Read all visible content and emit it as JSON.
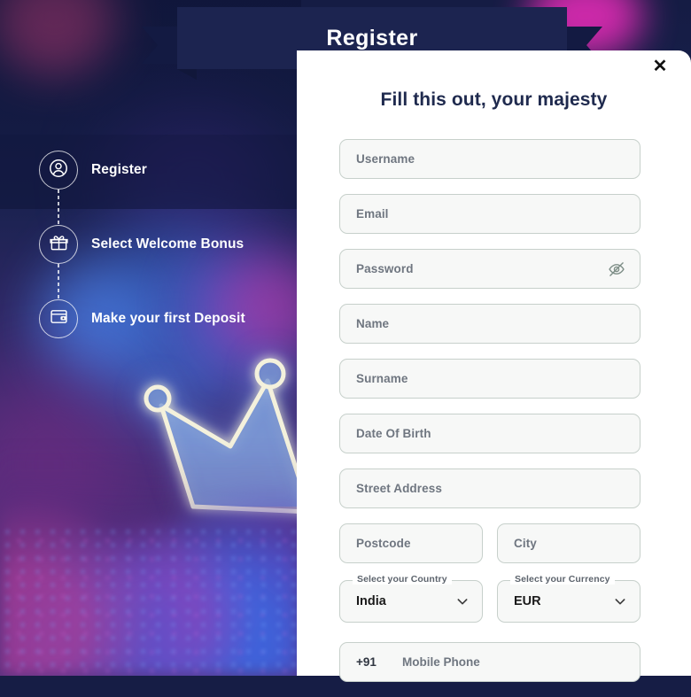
{
  "banner": {
    "title": "Register"
  },
  "modal": {
    "close_label": "✕",
    "heading": "Fill this out, your majesty"
  },
  "steps": [
    {
      "label": "Register",
      "icon": "user-icon"
    },
    {
      "label": "Select Welcome Bonus",
      "icon": "gift-icon"
    },
    {
      "label": "Make your first Deposit",
      "icon": "wallet-icon"
    }
  ],
  "form": {
    "fields": [
      {
        "name": "username",
        "placeholder": "Username"
      },
      {
        "name": "email",
        "placeholder": "Email"
      },
      {
        "name": "password",
        "placeholder": "Password",
        "icon": "eye-off-icon"
      },
      {
        "name": "name",
        "placeholder": "Name"
      },
      {
        "name": "surname",
        "placeholder": "Surname"
      },
      {
        "name": "date-of-birth",
        "placeholder": "Date Of Birth"
      },
      {
        "name": "street-address",
        "placeholder": "Street Address"
      }
    ],
    "postcode": {
      "placeholder": "Postcode"
    },
    "city": {
      "placeholder": "City"
    },
    "country": {
      "label": "Select your Country",
      "value": "India",
      "icon": "chevron-down-icon"
    },
    "currency": {
      "label": "Select your Currency",
      "value": "EUR",
      "icon": "chevron-down-icon"
    },
    "phone": {
      "prefix": "+91",
      "placeholder": "Mobile Phone"
    }
  },
  "colors": {
    "background_navy": "#161d45",
    "banner_navy": "#1c2450",
    "heading_navy": "#1f2a4e",
    "field_bg": "#f7f8f7",
    "field_border": "#c7d0cb",
    "placeholder": "#6f7680",
    "modal_bg": "#ffffff",
    "neon_crown": "#f2efd8",
    "accent_magenta": "#e02bb4"
  }
}
